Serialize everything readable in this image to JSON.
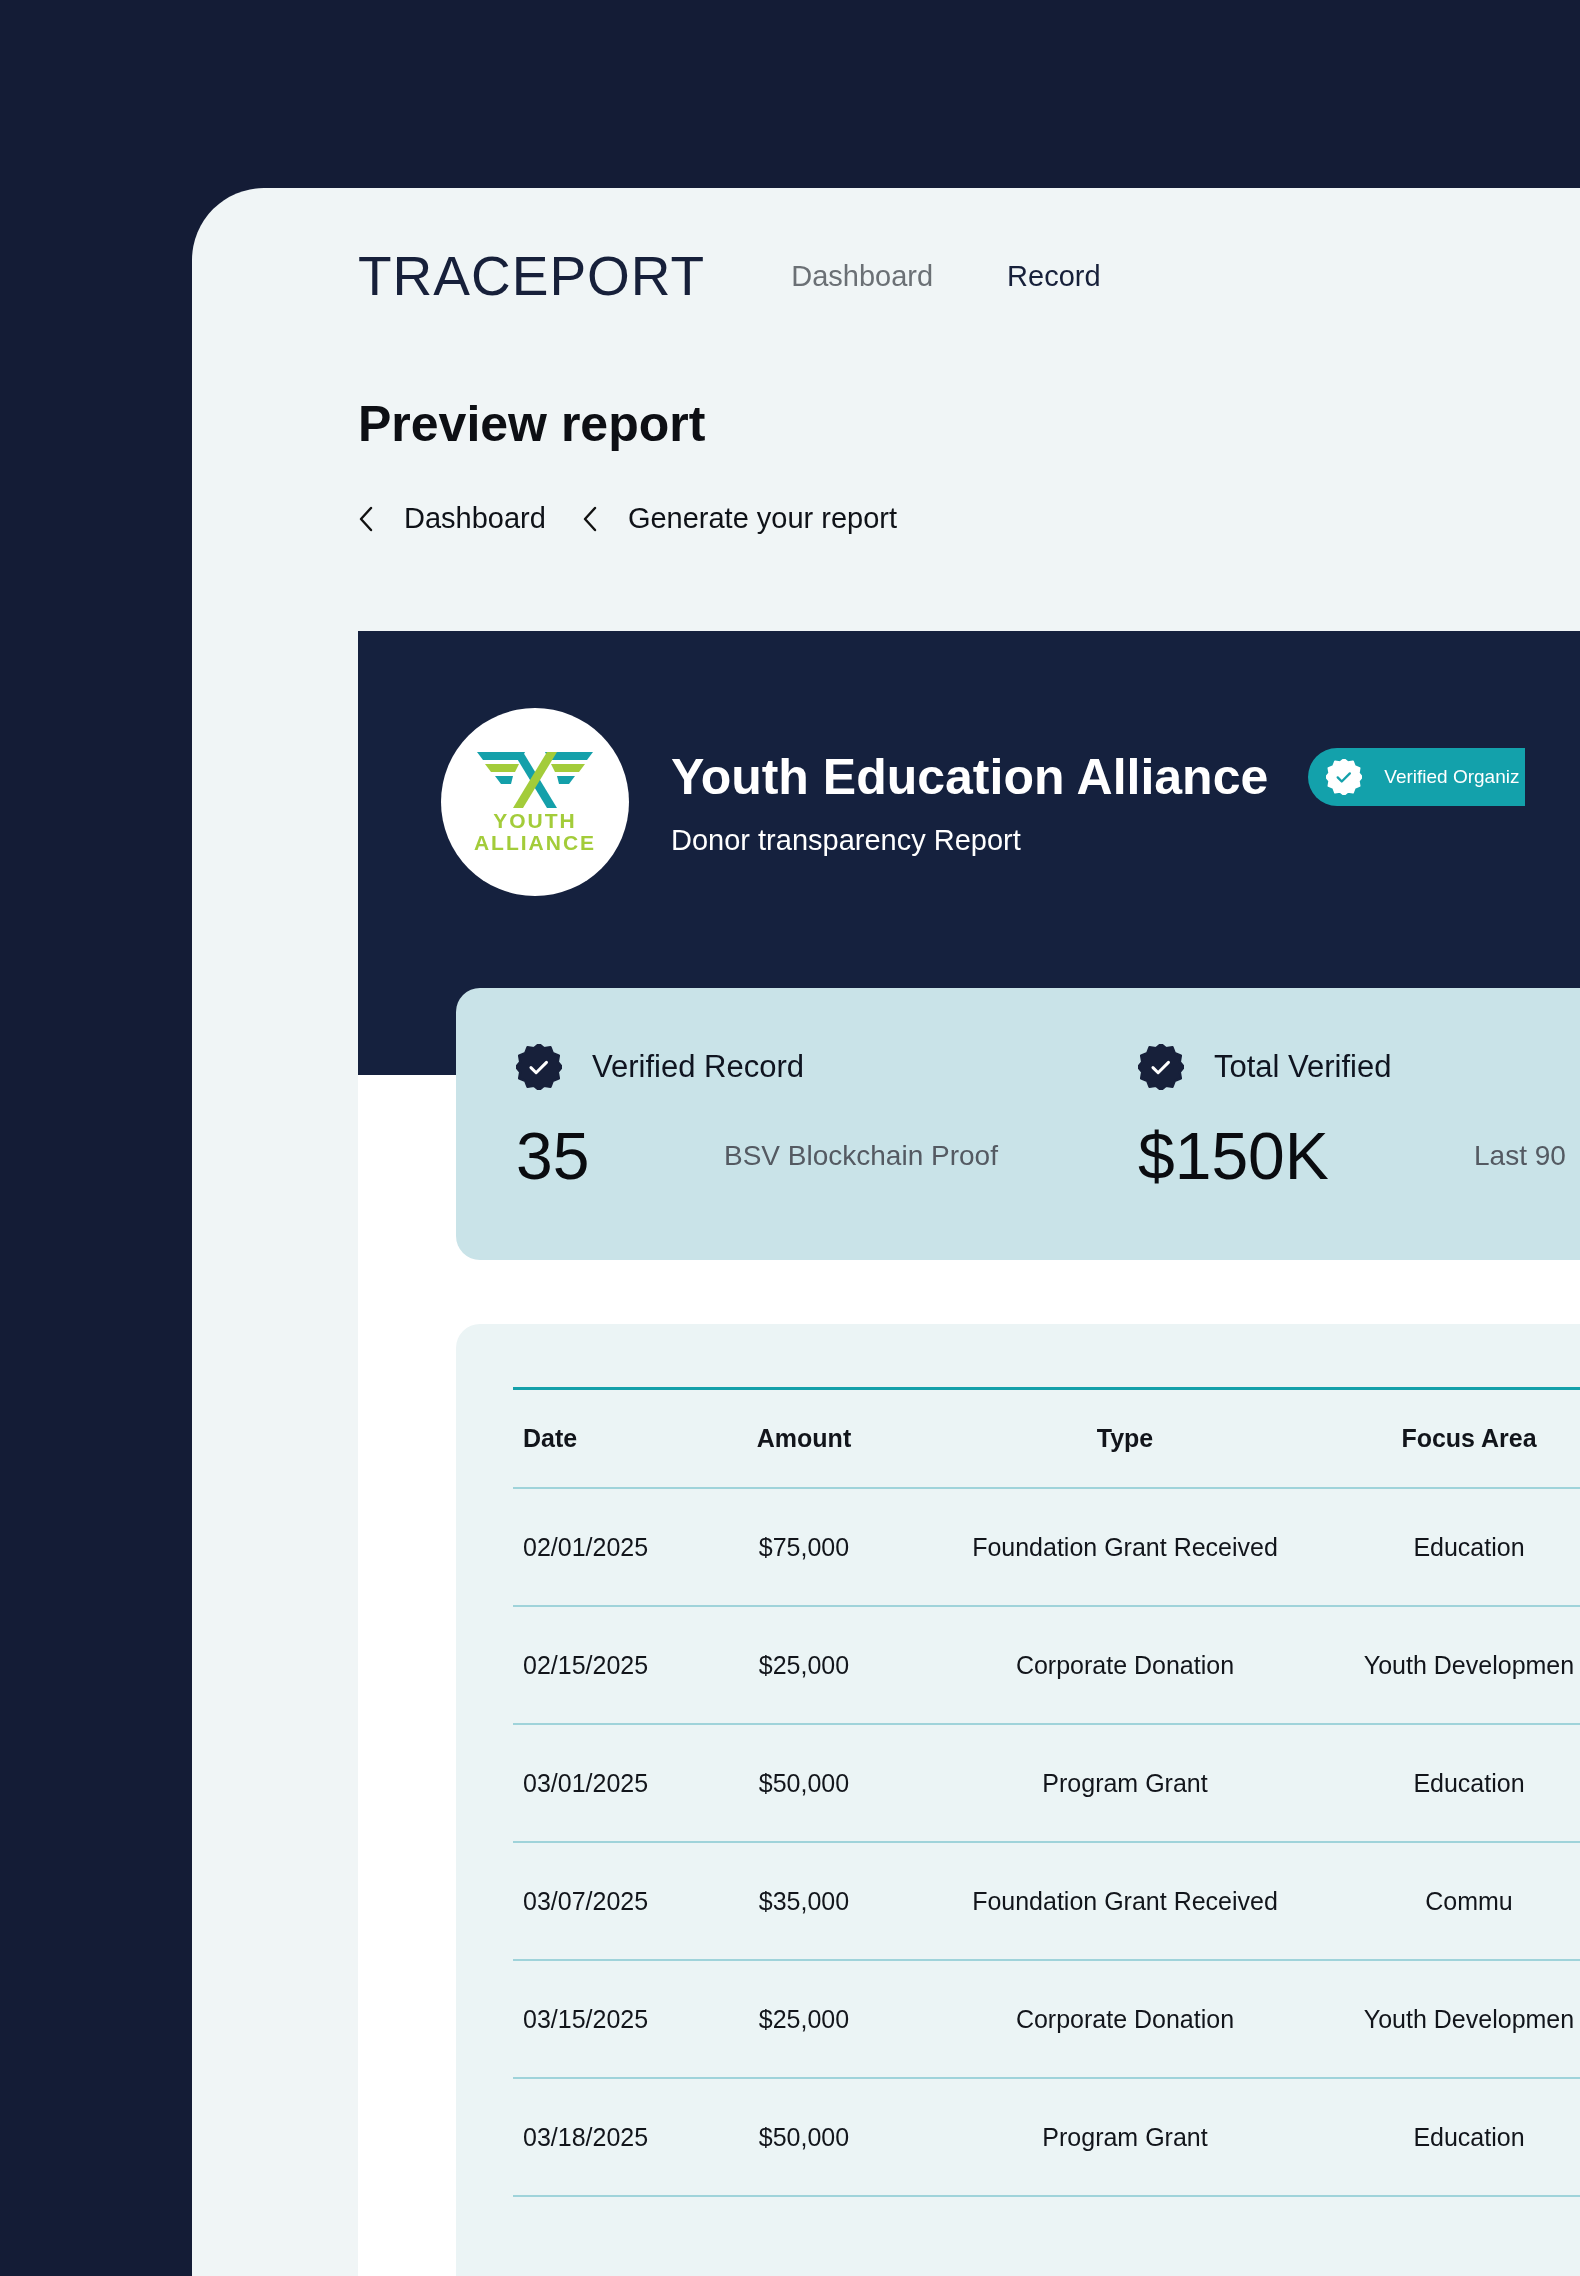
{
  "brand": "TRACEPORT",
  "nav": [
    {
      "label": "Dashboard",
      "selected": false
    },
    {
      "label": "Record",
      "selected": true
    }
  ],
  "page_title": "Preview report",
  "breadcrumbs": [
    "Dashboard",
    "Generate your report"
  ],
  "organization": {
    "logo_lines": [
      "YOUTH",
      "ALLIANCE"
    ],
    "name": "Youth Education Alliance",
    "subtitle": "Donor transparency Report",
    "badge": "Verified Organiz"
  },
  "stats": [
    {
      "label": "Verified Record",
      "value": "35",
      "note": "BSV Blockchain Proof"
    },
    {
      "label": "Total Verified",
      "value": "$150K",
      "note": "Last 90"
    }
  ],
  "table": {
    "columns": [
      "Date",
      "Amount",
      "Type",
      "Focus Area"
    ],
    "rows": [
      [
        "02/01/2025",
        "$75,000",
        "Foundation Grant Received",
        "Education"
      ],
      [
        "02/15/2025",
        "$25,000",
        "Corporate Donation",
        "Youth Developmen"
      ],
      [
        "03/01/2025",
        "$50,000",
        "Program Grant",
        "Education"
      ],
      [
        "03/07/2025",
        "$35,000",
        "Foundation Grant Received",
        "Commu"
      ],
      [
        "03/15/2025",
        "$25,000",
        "Corporate Donation",
        "Youth Developmen"
      ],
      [
        "03/18/2025",
        "$50,000",
        "Program Grant",
        "Education"
      ]
    ]
  }
}
